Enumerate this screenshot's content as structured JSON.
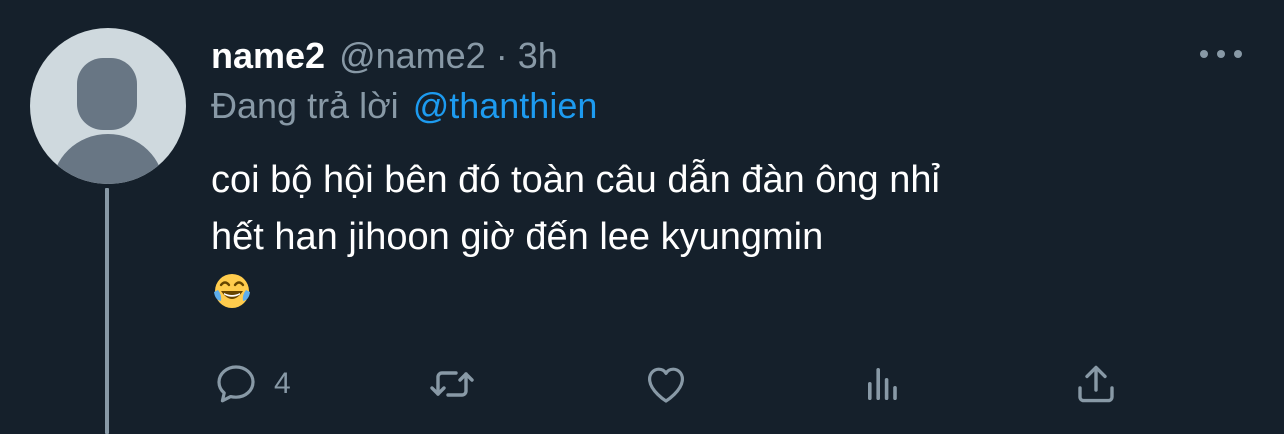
{
  "tweet": {
    "display_name": "name2",
    "handle": "@name2",
    "separator": "·",
    "time": "3h",
    "reply_prefix": "Đang trả lời",
    "reply_to": "@thanthien",
    "text_line1": "coi bộ hội bên đó toàn câu dẫn đàn ông nhỉ",
    "text_line2": "hết han jihoon giờ đến lee kyungmin",
    "emoji": "face-with-tears-of-joy"
  },
  "actions": {
    "reply_count": "4",
    "icons": [
      "reply-icon",
      "retweet-icon",
      "like-icon",
      "analytics-icon",
      "share-icon"
    ]
  },
  "colors": {
    "background": "#15202b",
    "text_primary": "#ffffff",
    "text_secondary": "#8899a6",
    "accent": "#1d9bf0",
    "avatar_bg": "#cfd9de",
    "avatar_figure": "#687684"
  }
}
